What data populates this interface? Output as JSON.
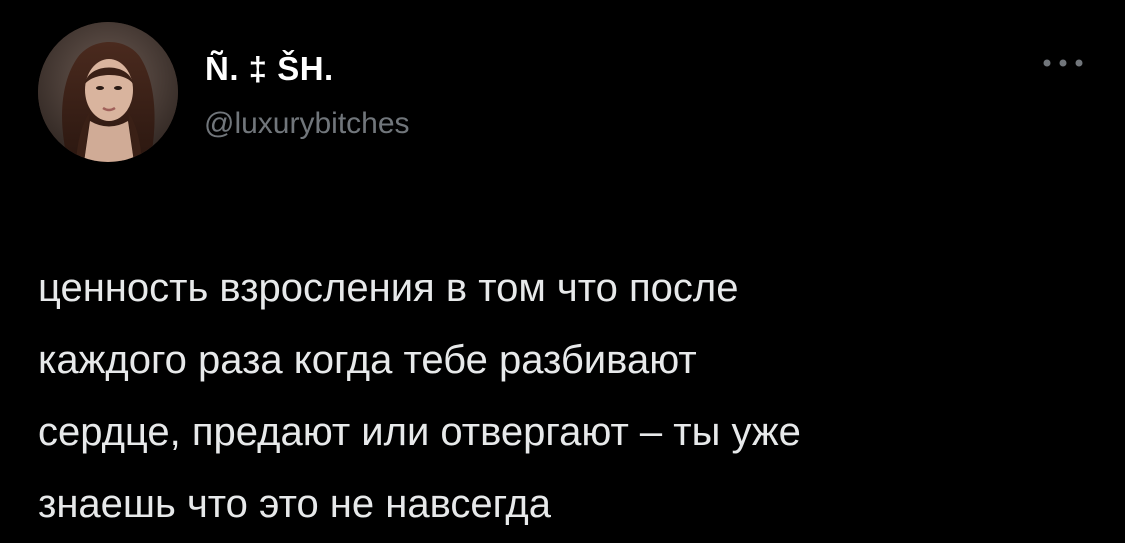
{
  "tweet": {
    "author": {
      "display_name": "Ñ. ‡ ŠH.",
      "handle": "@luxurybitches",
      "avatar_icon": "profile-photo-woman"
    },
    "more_icon": "more-horizontal-icon",
    "text": "ценность взросления в том что после\nкаждого раза когда тебе разбивают\nсердце, предают или отвергают – ты уже\nзнаешь что это не навсегда"
  },
  "colors": {
    "background": "#000000",
    "primary_text": "#e7e9ea",
    "secondary_text": "#71767b"
  }
}
